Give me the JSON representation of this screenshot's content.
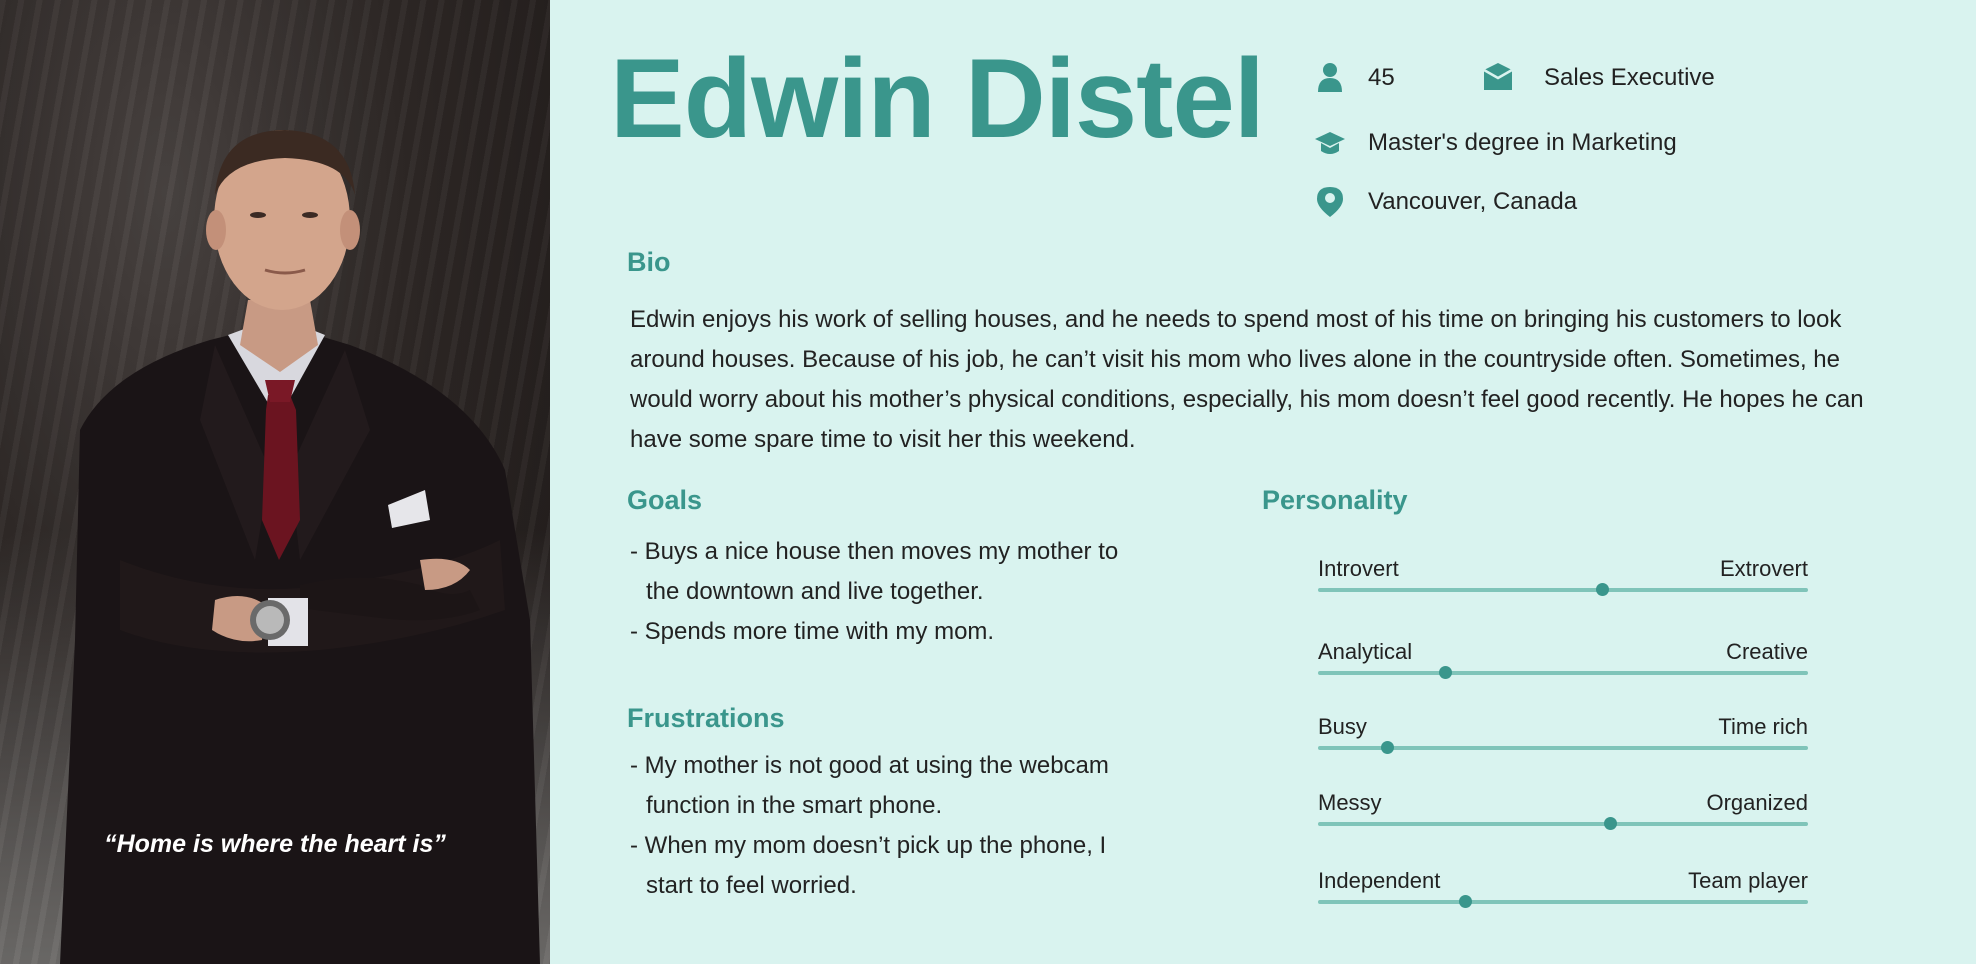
{
  "persona": {
    "name": "Edwin Distel",
    "quote": "“Home is where the heart is”",
    "age": "45",
    "occupation": "Sales Executive",
    "education": "Master's degree in Marketing",
    "location": "Vancouver, Canada"
  },
  "icons": {
    "age": "person-icon",
    "occupation": "briefcase-icon",
    "education": "graduation-cap-icon",
    "location": "location-pin-icon"
  },
  "bio": {
    "title": "Bio",
    "text": "Edwin enjoys his work of selling houses, and he needs to spend most of his time on bringing his customers to look around houses. Because of his job, he can’t visit his mom who lives alone in the countryside often. Sometimes, he would worry about his mother’s physical conditions, especially, his mom doesn’t feel good recently. He hopes he can have some spare time to visit her this weekend."
  },
  "goals": {
    "title": "Goals",
    "items": [
      "- Buys a nice house then moves my mother to the downtown and live together.",
      "- Spends more time with my mom."
    ]
  },
  "frustrations": {
    "title": "Frustrations",
    "items": [
      "- My mother is not good at using the webcam function in the smart phone.",
      "- When my mom doesn’t pick up the phone, I start to feel worried."
    ]
  },
  "personality": {
    "title": "Personality",
    "traits": [
      {
        "left": "Introvert",
        "right": "Extrovert",
        "value": 0.58
      },
      {
        "left": "Analytical",
        "right": "Creative",
        "value": 0.26
      },
      {
        "left": "Busy",
        "right": "Time rich",
        "value": 0.14
      },
      {
        "left": "Messy",
        "right": "Organized",
        "value": 0.595
      },
      {
        "left": "Independent",
        "right": "Team player",
        "value": 0.3
      }
    ]
  },
  "colors": {
    "accent": "#3a968c",
    "background": "#d9f3ef",
    "track": "#7fc4b9"
  }
}
